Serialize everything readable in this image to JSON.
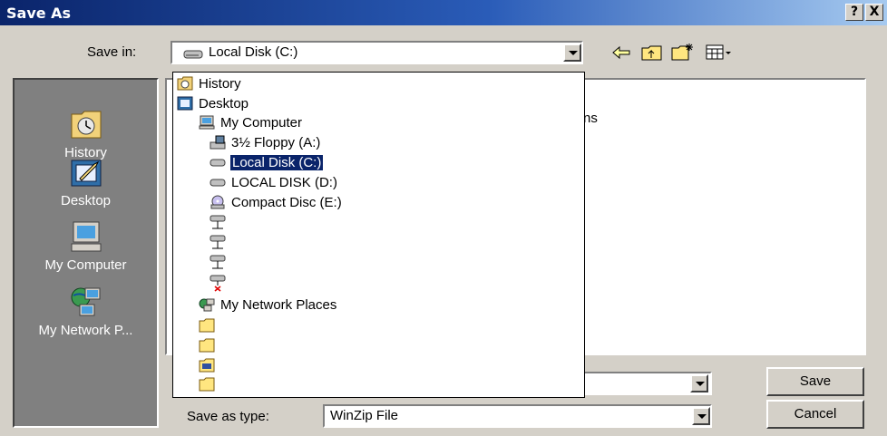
{
  "window": {
    "title": "Save As",
    "help_label": "?",
    "close_label": "X"
  },
  "save_in": {
    "label": "Save in:",
    "value": "Local Disk (C:)"
  },
  "toolbar": {
    "icons": [
      "back-arrow-icon",
      "up-folder-icon",
      "new-folder-icon",
      "view-menu-icon"
    ]
  },
  "places": [
    {
      "label": "History",
      "icon": "history-icon"
    },
    {
      "label": "Desktop",
      "icon": "desktop-icon"
    },
    {
      "label": "My Computer",
      "icon": "my-computer-icon"
    },
    {
      "label": "My Network P...",
      "icon": "network-places-icon"
    }
  ],
  "tree": [
    {
      "label": "History",
      "icon": "history-icon",
      "level": 0
    },
    {
      "label": "Desktop",
      "icon": "desktop-icon",
      "level": 0
    },
    {
      "label": "My Computer",
      "icon": "my-computer-icon",
      "level": 1
    },
    {
      "label": "3½ Floppy (A:)",
      "icon": "floppy-drive-icon",
      "level": 2
    },
    {
      "label": "Local Disk (C:)",
      "icon": "hard-disk-icon",
      "level": 2,
      "selected": true
    },
    {
      "label": "LOCAL DISK (D:)",
      "icon": "hard-disk-icon",
      "level": 2
    },
    {
      "label": "Compact Disc (E:)",
      "icon": "cd-drive-icon",
      "level": 2
    },
    {
      "label": "",
      "icon": "network-drive-icon",
      "level": 2
    },
    {
      "label": "",
      "icon": "network-drive-icon",
      "level": 2
    },
    {
      "label": "",
      "icon": "network-drive-icon",
      "level": 2
    },
    {
      "label": "",
      "icon": "disconnected-network-drive-icon",
      "level": 2
    },
    {
      "label": "My Network Places",
      "icon": "network-places-icon",
      "level": 1
    },
    {
      "label": "",
      "icon": "folder-icon",
      "level": 1
    },
    {
      "label": "",
      "icon": "folder-icon",
      "level": 1
    },
    {
      "label": "",
      "icon": "shared-folder-icon",
      "level": 1
    },
    {
      "label": "",
      "icon": "folder-icon",
      "level": 1
    }
  ],
  "file_area": {
    "partial_text": "ns"
  },
  "file_name": {
    "value": ""
  },
  "save_as_type": {
    "label": "Save as type:",
    "value": "WinZip File"
  },
  "buttons": {
    "save": "Save",
    "cancel": "Cancel"
  },
  "colors": {
    "title_bar": "#0a246a",
    "selection": "#0a246a",
    "face": "#d4d0c8",
    "places_bg": "#808080"
  }
}
